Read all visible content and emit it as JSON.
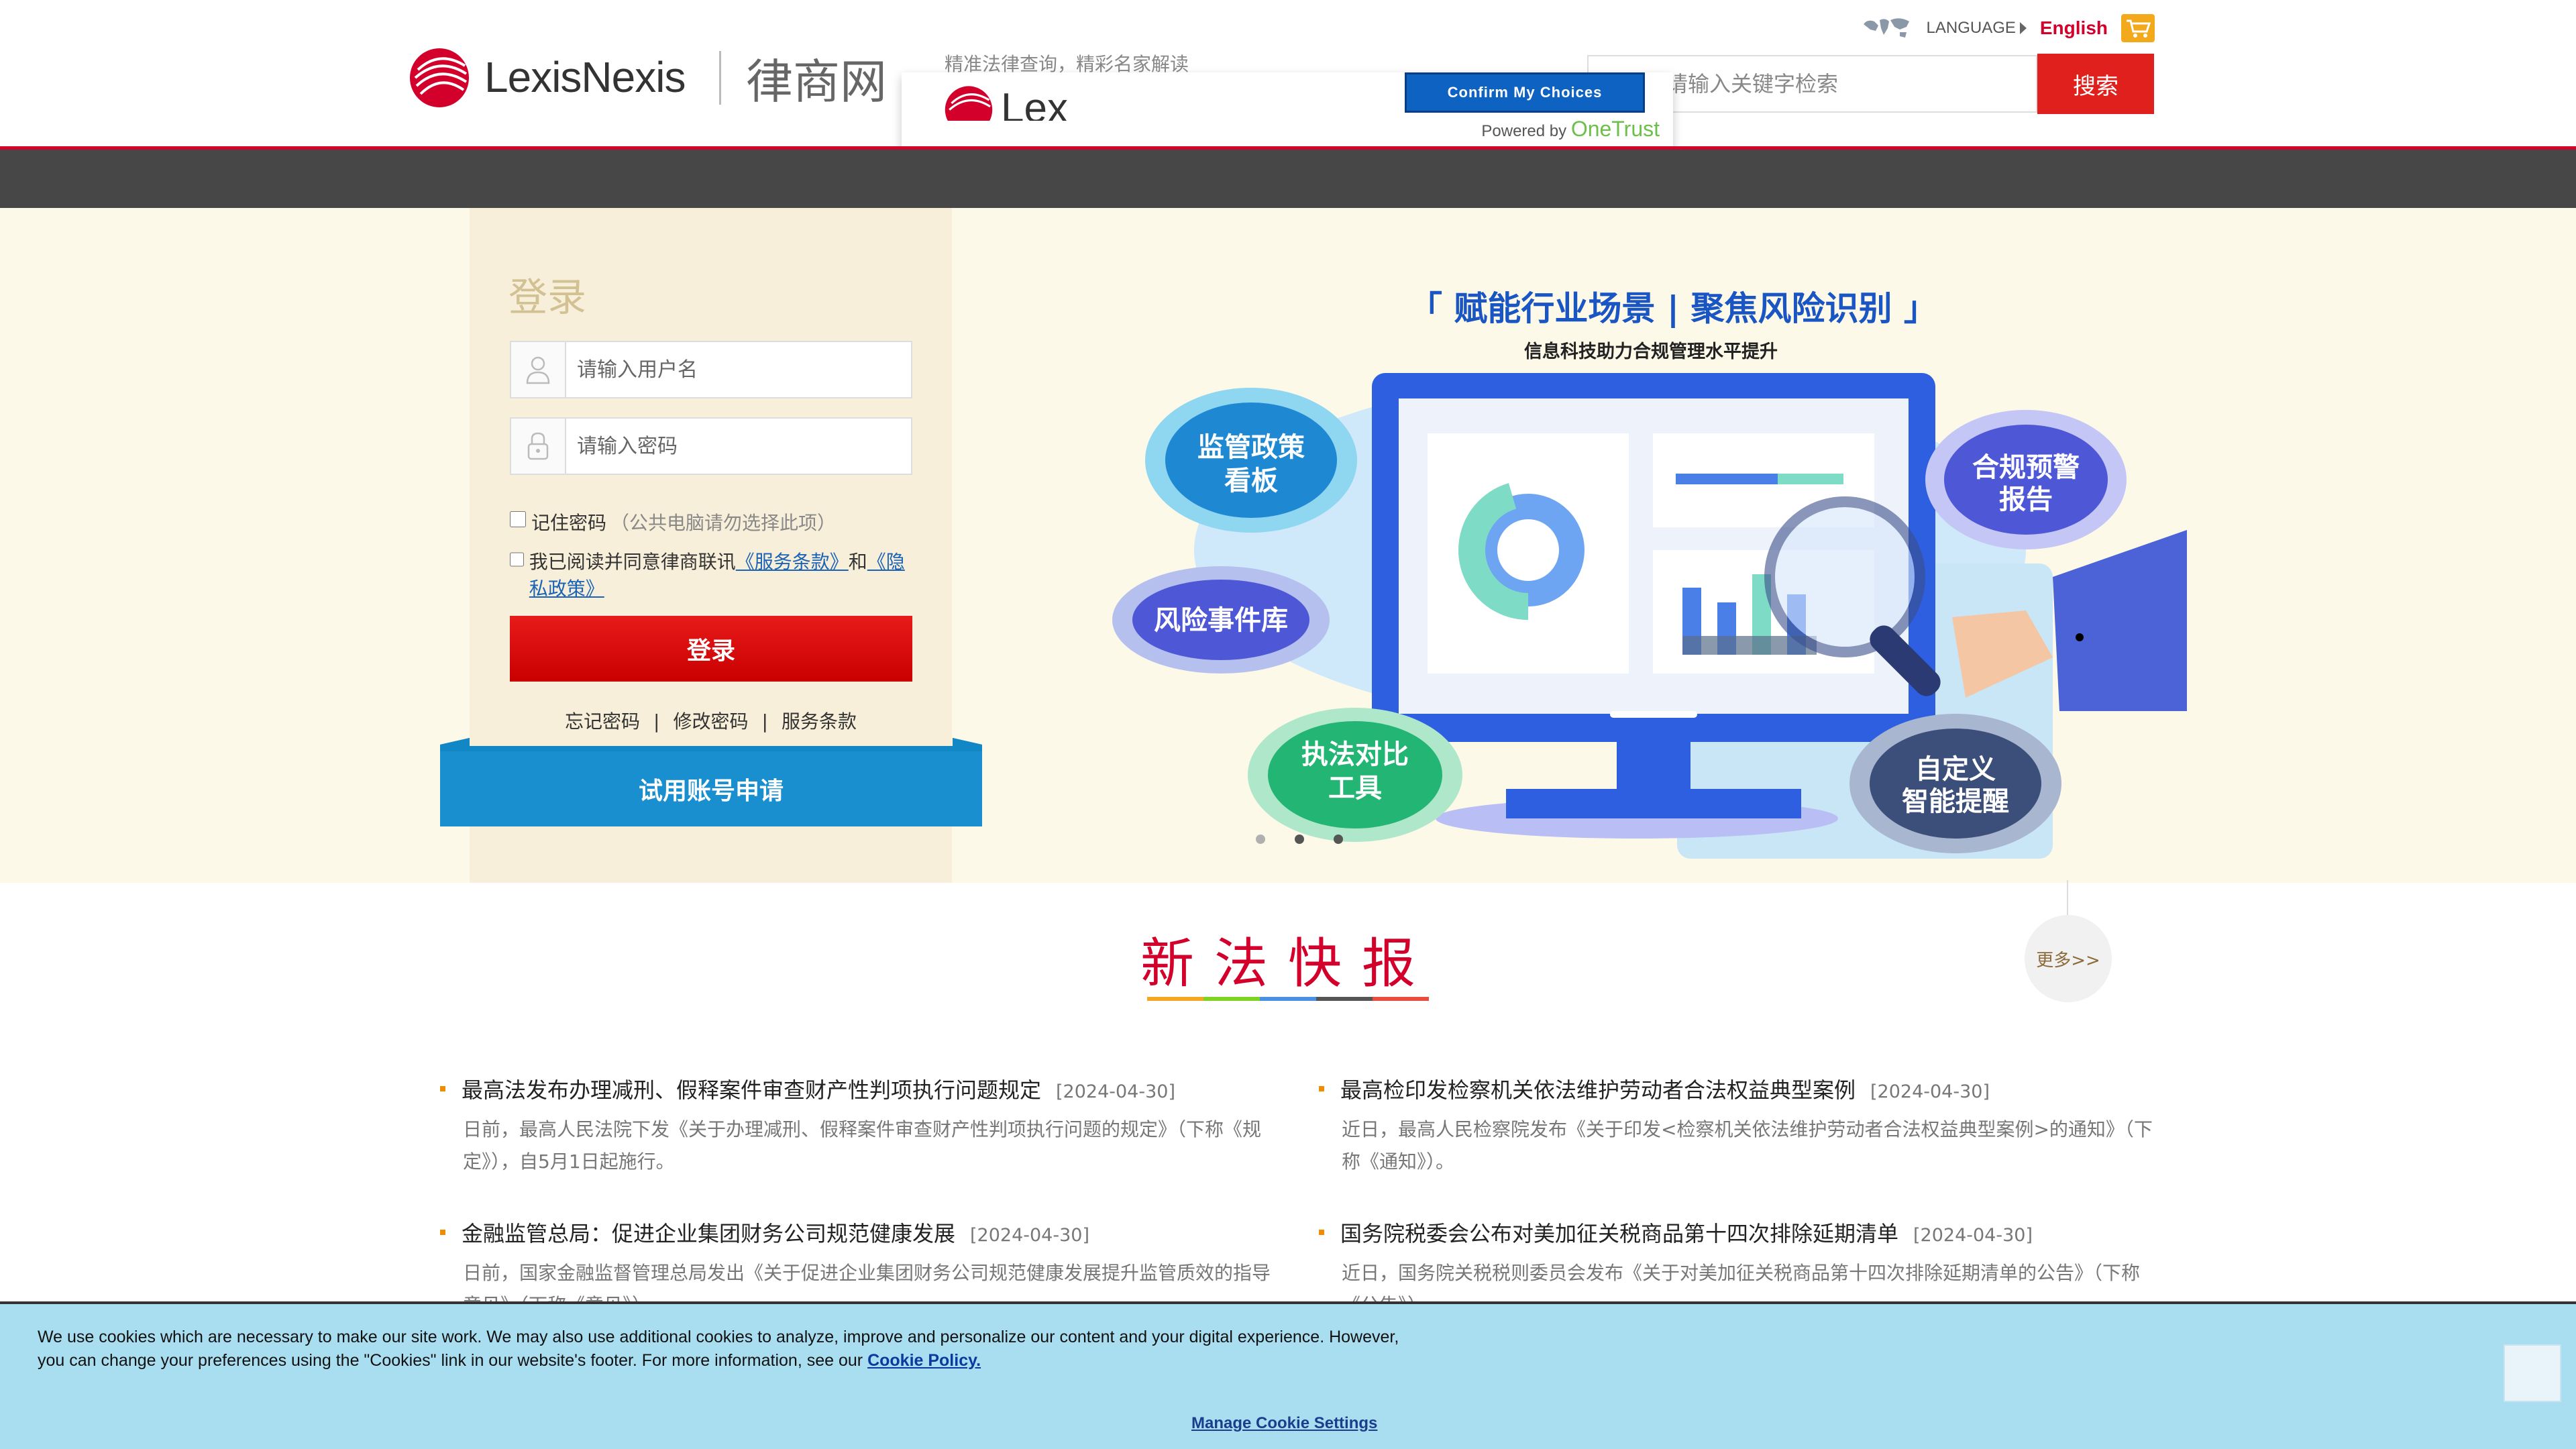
{
  "header": {
    "logo_text": "LexisNexis",
    "logo_cn": "律商网",
    "tagline": "精准法律查询，精彩名家解读",
    "language_label": "LANGUAGE",
    "english_label": "English",
    "search": {
      "placeholder": "请输入关键字检索",
      "button_label": "搜索"
    }
  },
  "onetrust": {
    "logo_text": "Lex",
    "confirm_label": "Confirm My Choices",
    "powered_by": "Powered by",
    "brand": "OneTrust"
  },
  "login": {
    "title": "登录",
    "username_placeholder": "请输入用户名",
    "password_placeholder": "请输入密码",
    "remember_label": "记住密码",
    "remember_note": "（公共电脑请勿选择此项）",
    "agree_prefix": "我已阅读并同意律商联讯",
    "terms_link": "《服务条款》",
    "and_text": "和",
    "privacy_link": "《隐私政策》",
    "submit_label": "登录",
    "links": [
      "忘记密码",
      "修改密码",
      "服务条款"
    ],
    "trial_label": "试用账号申请"
  },
  "banner": {
    "headline": "「 赋能行业场景 | 聚焦风险识别 」",
    "subhead": "信息科技助力合规管理水平提升",
    "bubbles": {
      "policy_board": [
        "监管政策",
        "看板"
      ],
      "risk_events": [
        "风险事件库"
      ],
      "enforcement": [
        "执法对比",
        "工具"
      ],
      "compliance_alert": [
        "合规预警",
        "报告"
      ],
      "custom_reminder": [
        "自定义",
        "智能提醒"
      ]
    },
    "colors": {
      "blue": "#1e6fd9",
      "green": "#22b573",
      "purple": "#4e57d6",
      "dark": "#3c4f7a"
    },
    "active_slide": 2,
    "slide_count": 3
  },
  "news": {
    "title": "新法快报",
    "more_label": "更多>>",
    "items": [
      {
        "title": "最高法发布办理减刑、假释案件审查财产性判项执行问题规定",
        "date": "[2024-04-30]",
        "summary": "日前，最高人民法院下发《关于办理减刑、假释案件审查财产性判项执行问题的规定》（下称《规定》），自5月1日起施行。"
      },
      {
        "title": "最高检印发检察机关依法维护劳动者合法权益典型案例",
        "date": "[2024-04-30]",
        "summary": "近日，最高人民检察院发布《关于印发<检察机关依法维护劳动者合法权益典型案例>的通知》（下称《通知》）。"
      },
      {
        "title": "金融监管总局：促进企业集团财务公司规范健康发展",
        "date": "[2024-04-30]",
        "summary": "日前，国家金融监督管理总局发出《关于促进企业集团财务公司规范健康发展提升监管质效的指导意见》（下称《意见》）"
      },
      {
        "title": "国务院税委会公布对美加征关税商品第十四次排除延期清单",
        "date": "[2024-04-30]",
        "summary": "近日，国务院关税税则委员会发布《关于对美加征关税商品第十四次排除延期清单的公告》（下称《公告》）"
      }
    ]
  },
  "cookie": {
    "text": "We use cookies which are necessary to make our site work. We may also use additional cookies to analyze, improve and personalize our content and your digital experience. However, you can change your preferences using the \"Cookies\" link in our website's footer. For more information, see our",
    "policy_link": "Cookie Policy.",
    "manage_label": "Manage Cookie Settings"
  },
  "colors": {
    "brand_red": "#d2002a",
    "nav_gray": "#474747",
    "hero_bg": "#fdf9e8",
    "cookie_bg": "#a9def1"
  }
}
